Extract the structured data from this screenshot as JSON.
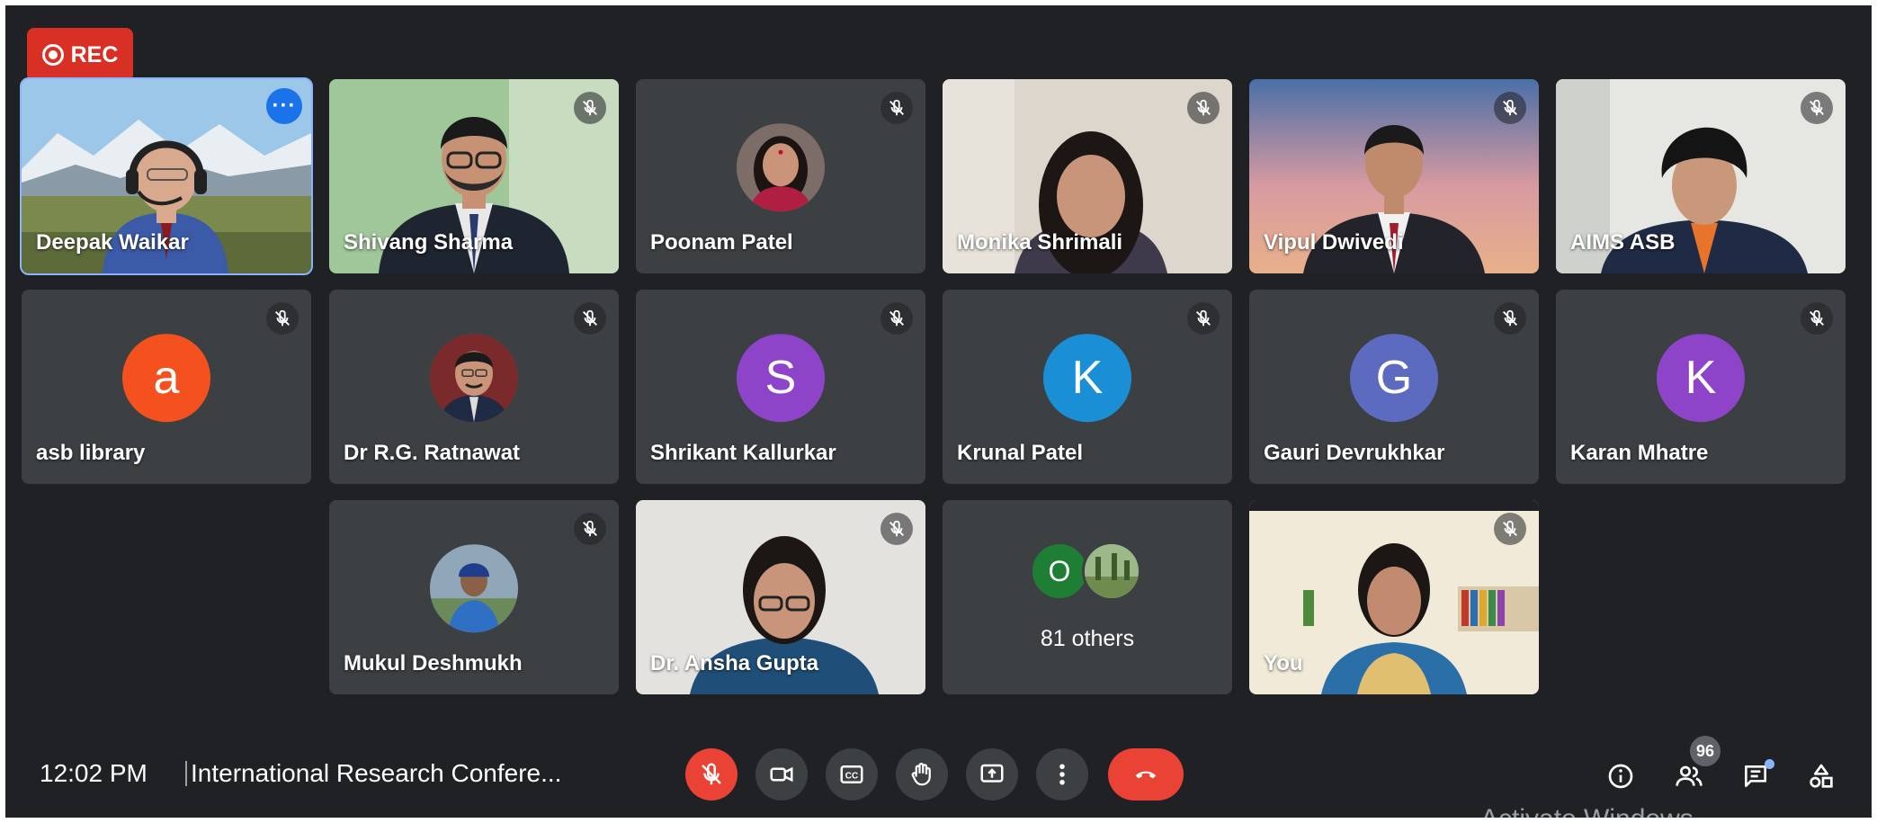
{
  "recording": {
    "label": "REC"
  },
  "participants": [
    {
      "name": "Deepak Waikar",
      "tile": "video"
    },
    {
      "name": "Shivang Sharma",
      "tile": "video"
    },
    {
      "name": "Poonam Patel",
      "tile": "photo"
    },
    {
      "name": "Monika Shrimali",
      "tile": "video"
    },
    {
      "name": "Vipul Dwivedi",
      "tile": "video"
    },
    {
      "name": "AIMS ASB",
      "tile": "video"
    },
    {
      "name": "asb library",
      "initial": "a",
      "color": "#f4511e"
    },
    {
      "name": "Dr R.G. Ratnawat",
      "tile": "photo"
    },
    {
      "name": "Shrikant Kallurkar",
      "initial": "S",
      "color": "#8e44c9"
    },
    {
      "name": "Krunal Patel",
      "initial": "K",
      "color": "#1a8fd6"
    },
    {
      "name": "Gauri Devrukhkar",
      "initial": "G",
      "color": "#5c6bc0"
    },
    {
      "name": "Karan Mhatre",
      "initial": "K",
      "color": "#8e44c9"
    },
    {
      "name": "Mukul Deshmukh",
      "tile": "photo"
    },
    {
      "name": "Dr. Ansha Gupta",
      "tile": "video"
    },
    {
      "name": "You",
      "tile": "video"
    }
  ],
  "others": {
    "initial": "O",
    "color": "#1e7e34",
    "label": "81 others"
  },
  "bottom_bar": {
    "time": "12:02 PM",
    "meeting_title": "International Research Confere...",
    "participant_count": "96"
  },
  "controls": {
    "mic": "mic-off-icon",
    "camera": "camera-icon",
    "captions": "captions-icon",
    "raise_hand": "raise-hand-icon",
    "present": "present-screen-icon",
    "more": "more-options-icon",
    "leave": "leave-call-icon"
  },
  "side_icons": [
    "info-icon",
    "people-icon",
    "chat-icon",
    "activities-icon"
  ],
  "colors": {
    "background": "#202124",
    "tile": "#3c4043",
    "danger": "#ea4335",
    "speaking_outline": "#8ab4f8",
    "accent": "#1a73e8"
  },
  "watermark": "Activate Windows"
}
